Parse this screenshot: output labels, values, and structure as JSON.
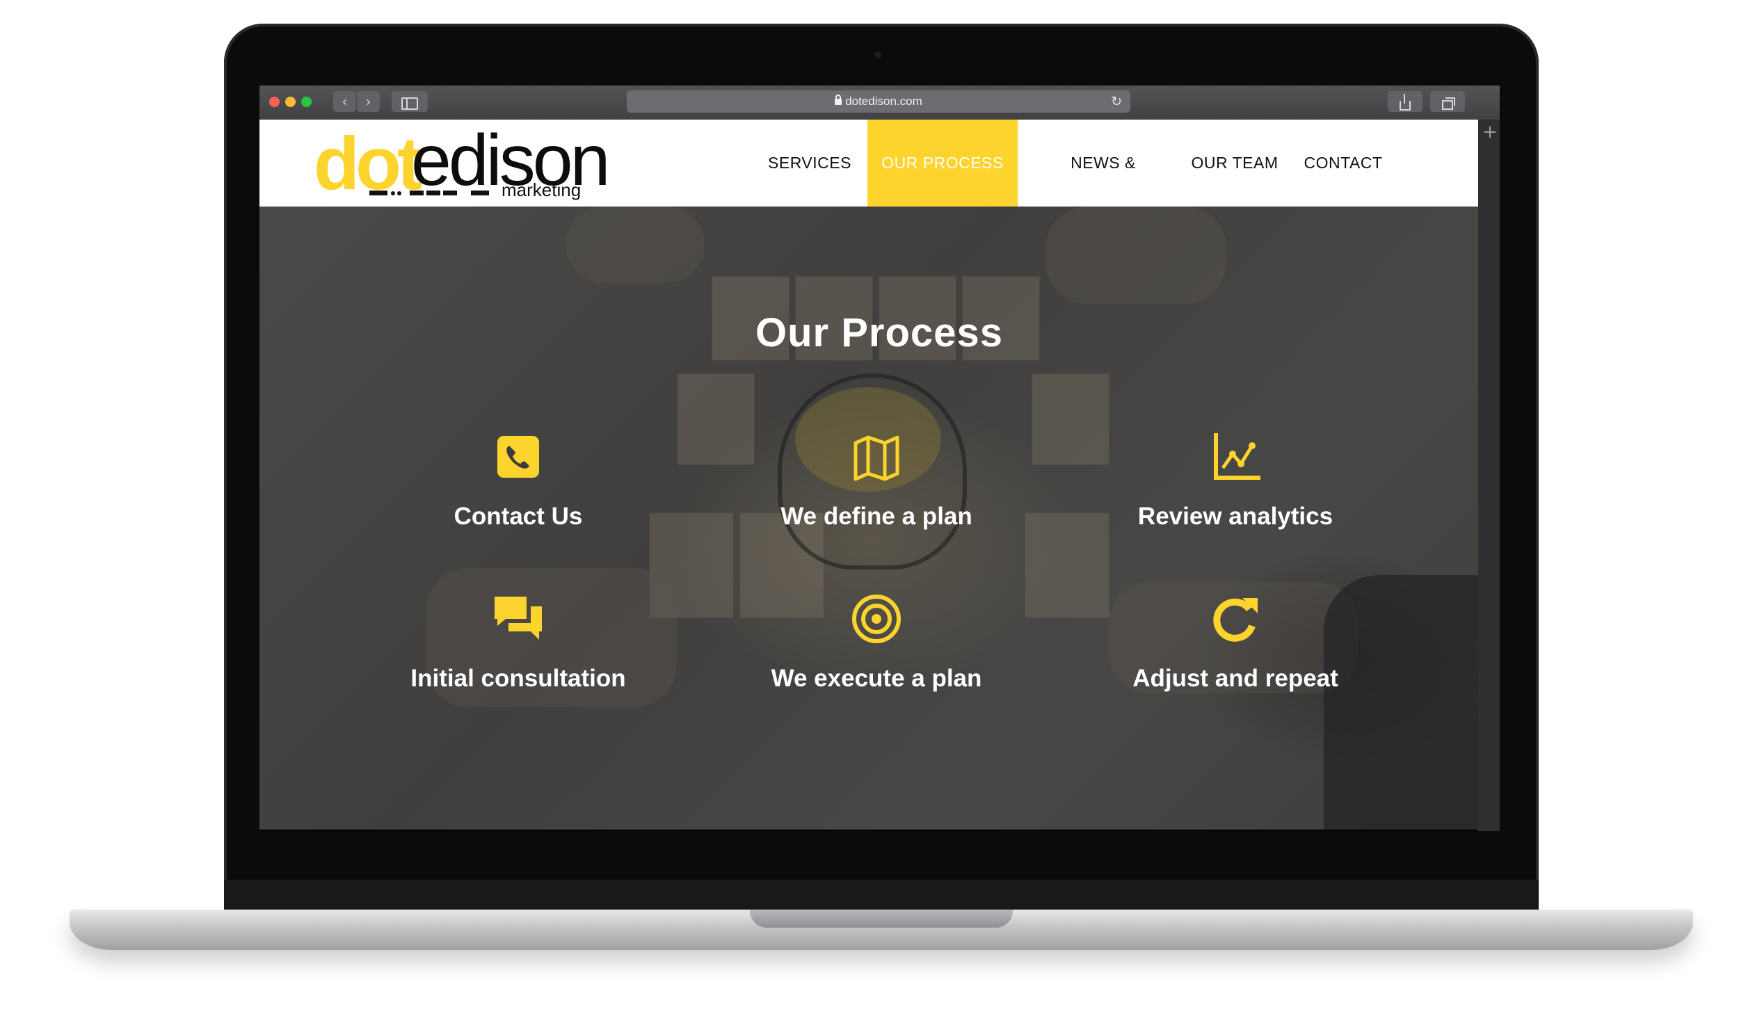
{
  "browser": {
    "url": "dotedison.com",
    "back_glyph": "‹",
    "forward_glyph": "›",
    "reload_glyph": "↻",
    "newtab_glyph": "+"
  },
  "logo": {
    "dot": "dot",
    "edison": "edison",
    "marketing": "marketing",
    "accent_color": "#fdd32d"
  },
  "nav": {
    "items": [
      {
        "label": "SERVICES"
      },
      {
        "label": "OUR PROCESS",
        "active": true
      },
      {
        "label": "NEWS & INSIGHTS"
      },
      {
        "label": "OUR TEAM"
      },
      {
        "label": "CONTACT"
      }
    ]
  },
  "hero": {
    "title": "Our Process",
    "steps": [
      {
        "label": "Contact Us",
        "icon": "phone-icon"
      },
      {
        "label": "We define a plan",
        "icon": "map-icon"
      },
      {
        "label": "Review analytics",
        "icon": "line-chart-icon"
      },
      {
        "label": "Initial consultation",
        "icon": "chat-bubbles-icon"
      },
      {
        "label": "We execute a plan",
        "icon": "target-icon"
      },
      {
        "label": "Adjust and repeat",
        "icon": "redo-icon"
      }
    ],
    "icon_color": "#fdd32d"
  }
}
